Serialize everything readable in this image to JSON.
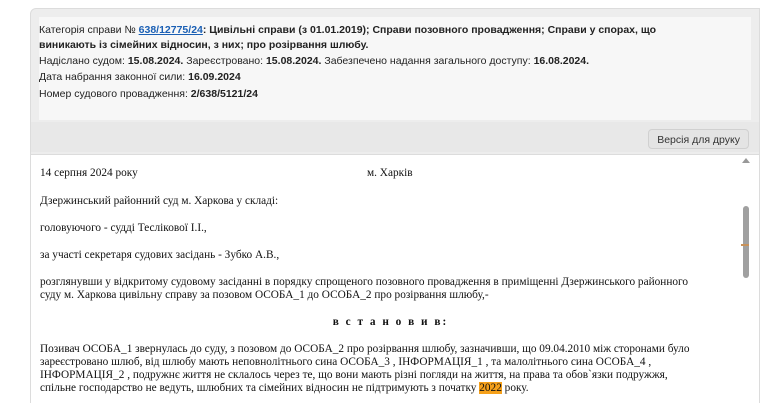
{
  "case_info": {
    "category_label": "Категорія справи №",
    "case_number": "638/12775/24",
    "category_text_1": ": Цивільні справи (з 01.01.2019); Справи позовного провадження; Справи у спорах, що",
    "category_text_2": "виникають із сімейних відносин, з них; про розірвання шлюбу.",
    "sent_label": "Надіслано судом:",
    "sent_date": "15.08.2024.",
    "registered_label": "Зареєстровано:",
    "registered_date": "15.08.2024.",
    "access_label": "Забезпечено надання загального доступу:",
    "access_date": "16.08.2024.",
    "effective_label": "Дата набрання законної сили:",
    "effective_date": "16.09.2024",
    "proceeding_label": "Номер судового провадження:",
    "proceeding_number": "2/638/5121/24"
  },
  "toolbar": {
    "print_label": "Версія для друку"
  },
  "document": {
    "date": "14 серпня 2024 року",
    "city": "м. Харків",
    "court": "Дзержинський районний суд  м. Харкова у складі:",
    "judge": "головуючого - судді Теслікової І.І.,",
    "secretary": "за участі секретаря судових засідань - Зубко А.В.,",
    "review_1": "розглянувши у відкритому судовому засіданні в порядку спрощеного позовного провадження в приміщенні Дзержинського районного",
    "review_2": "суду м. Харкова цивільну справу за позовом  ОСОБА_1 до ОСОБА_2 про розірвання шлюбу,-",
    "established": "в с т а н о в и в:",
    "claim_1": "Позивач ОСОБА_1 звернулась до суду, з позовом до  ОСОБА_2 про розірвання шлюбу, зазначивши, що 09.04.2010 між сторонами було",
    "claim_2": "зареєстровано шлюб, від шлюбу мають неповнолітнього сина ОСОБА_3 , ІНФОРМАЦІЯ_1 , та малолітнього сина ОСОБА_4 ,",
    "claim_3": "ІНФОРМАЦІЯ_2 , подружнє життя не склалось через те, що вони мають різні погляди на життя, на права та обов`язки подружжя,",
    "claim_4_before": "спільне господарство не ведуть, шлюбних та сімейних відносин не підтримують з початку ",
    "claim_4_highlight": "2022",
    "claim_4_after": " року."
  },
  "colors": {
    "link": "#1a5fb4",
    "highlight": "#f5a01a",
    "panel_bg": "#ededed"
  }
}
